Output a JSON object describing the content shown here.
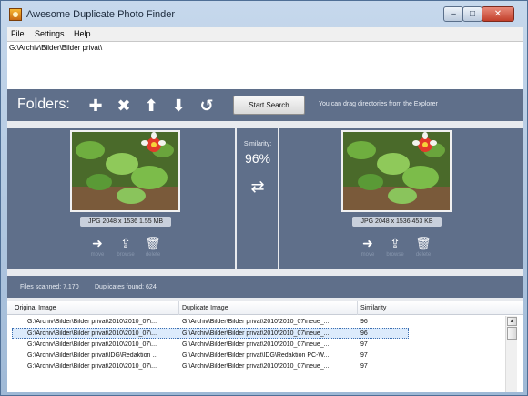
{
  "window": {
    "title": "Awesome Duplicate Photo Finder"
  },
  "menu": [
    "File",
    "Settings",
    "Help"
  ],
  "folders": {
    "entries": [
      "G:\\Archiv\\Bilder\\Bilder privat\\"
    ],
    "label": "Folders:",
    "start_button": "Start Search",
    "hint": "You can drag directories from the Explorer"
  },
  "compare": {
    "left": {
      "info": "JPG  2048 x 1536  1.55 MB",
      "actions": [
        "move",
        "browse",
        "delete"
      ]
    },
    "right": {
      "info": "JPG  2048 x 1536  453 KB",
      "actions": [
        "move",
        "browse",
        "delete"
      ]
    },
    "similarity_label": "Similarity:",
    "similarity_value": "96%"
  },
  "status": {
    "files_scanned": "Files scanned: 7,170",
    "duplicates_found": "Duplicates found: 624"
  },
  "table": {
    "headers": [
      "Original Image",
      "Duplicate Image",
      "Similarity"
    ],
    "rows": [
      [
        "G:\\Archiv\\Bilder\\Bilder privat\\2010\\2010_07\\...",
        "G:\\Archiv\\Bilder\\Bilder privat\\2010\\2010_07\\neue_...",
        "96"
      ],
      [
        "G:\\Archiv\\Bilder\\Bilder privat\\2010\\2010_07\\...",
        "G:\\Archiv\\Bilder\\Bilder privat\\2010\\2010_07\\neue_...",
        "96"
      ],
      [
        "G:\\Archiv\\Bilder\\Bilder privat\\2010\\2010_07\\...",
        "G:\\Archiv\\Bilder\\Bilder privat\\2010\\2010_07\\neue_...",
        "97"
      ],
      [
        "G:\\Archiv\\Bilder\\Bilder privat\\IDG\\Redaktion ...",
        "G:\\Archiv\\Bilder\\Bilder privat\\IDG\\Redaktion PC-W...",
        "97"
      ],
      [
        "G:\\Archiv\\Bilder\\Bilder privat\\2010\\2010_07\\...",
        "G:\\Archiv\\Bilder\\Bilder privat\\2010\\2010_07\\neue_...",
        "97"
      ]
    ],
    "selected_row": 1
  }
}
